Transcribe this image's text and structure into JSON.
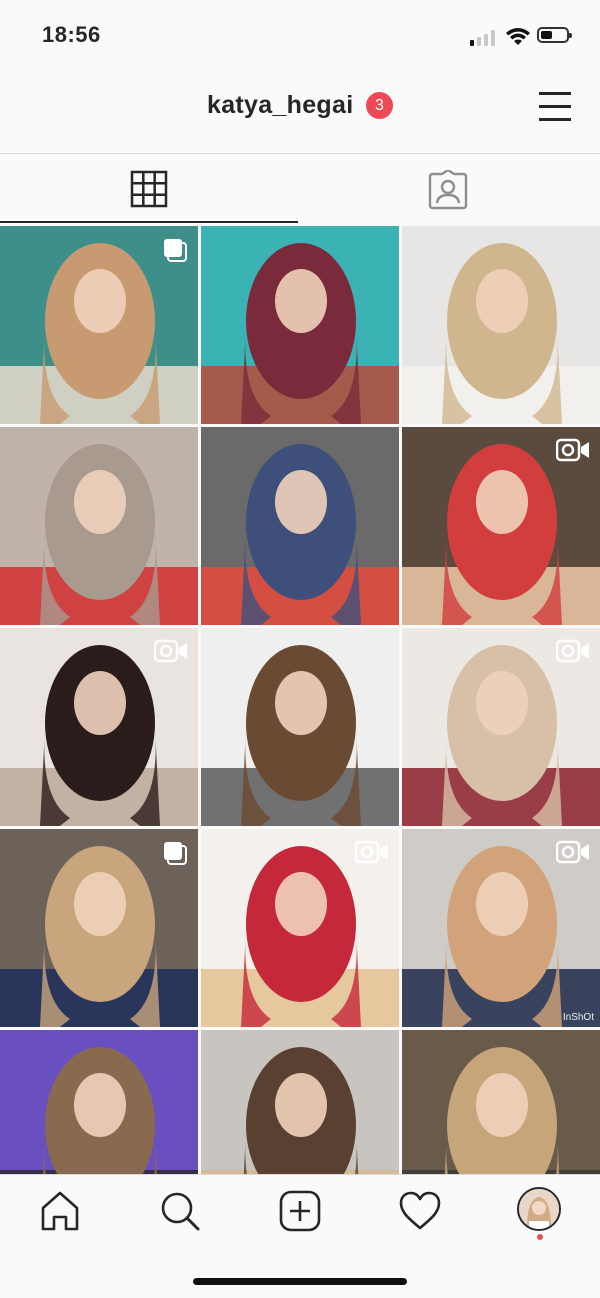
{
  "status_bar": {
    "time": "18:56",
    "battery_level": 0.45
  },
  "header": {
    "username": "katya_hegai",
    "notification_count": "3"
  },
  "tabs": [
    {
      "name": "grid",
      "icon": "grid-icon",
      "active": true
    },
    {
      "name": "tagged",
      "icon": "tagged-person-icon",
      "active": false
    }
  ],
  "posts": [
    {
      "desc": "selfie long wavy hair",
      "indicator": "carousel",
      "colors": [
        "#3e8f8a",
        "#c89a72",
        "#e9dccd"
      ]
    },
    {
      "desc": "red hair mirror selfie",
      "indicator": "",
      "colors": [
        "#3bb3b4",
        "#7a2a3a",
        "#b84a3a"
      ]
    },
    {
      "desc": "blonde beach waves",
      "indicator": "",
      "colors": [
        "#e8e6e4",
        "#cfb68f",
        "#f3f1ee"
      ]
    },
    {
      "desc": "ash blonde before after",
      "indicator": "",
      "colors": [
        "#bfb3ab",
        "#a89a8f",
        "#d12e2e"
      ]
    },
    {
      "desc": "denim overalls selfie",
      "indicator": "",
      "colors": [
        "#6a6a6a",
        "#3d4f7a",
        "#e64a3a"
      ]
    },
    {
      "desc": "makeup session",
      "indicator": "video",
      "colors": [
        "#5b4a3e",
        "#d23d3d",
        "#f0c9a8"
      ]
    },
    {
      "desc": "curling iron styling",
      "indicator": "video",
      "colors": [
        "#e9e4df",
        "#2a1c1a",
        "#bca99a"
      ]
    },
    {
      "desc": "brunette waves before after",
      "indicator": "",
      "colors": [
        "#efefef",
        "#6b4a33",
        "#5a5a5a"
      ]
    },
    {
      "desc": "salon styling phone",
      "indicator": "video",
      "colors": [
        "#ece8e4",
        "#d8c0a8",
        "#8b1e2a"
      ]
    },
    {
      "desc": "long curls polka dot blouse",
      "indicator": "carousel",
      "colors": [
        "#6c625a",
        "#c8a57c",
        "#1f2e5c"
      ]
    },
    {
      "desc": "red blouse curls collage",
      "indicator": "video",
      "colors": [
        "#f4f1ec",
        "#c5283a",
        "#e3c190"
      ]
    },
    {
      "desc": "hair styling hairdryer",
      "indicator": "video",
      "colors": [
        "#cfcbc6",
        "#d2a27a",
        "#1f2c4a"
      ]
    },
    {
      "desc": "braided updo",
      "indicator": "",
      "colors": [
        "#6a4fc0",
        "#8a6a4e",
        "#2a2a2a"
      ]
    },
    {
      "desc": "half up twist",
      "indicator": "",
      "colors": [
        "#c8c4c0",
        "#5a4030",
        "#d4b88c"
      ]
    },
    {
      "desc": "glasses portrait",
      "indicator": "",
      "colors": [
        "#6a5a4a",
        "#c7a57a",
        "#3a3a3a"
      ]
    }
  ],
  "watermark_text": "InShOt",
  "tab_bar": {
    "items": [
      "home-icon",
      "search-icon",
      "new-post-icon",
      "activity-heart-icon",
      "profile-avatar"
    ],
    "profile_notification": true
  }
}
